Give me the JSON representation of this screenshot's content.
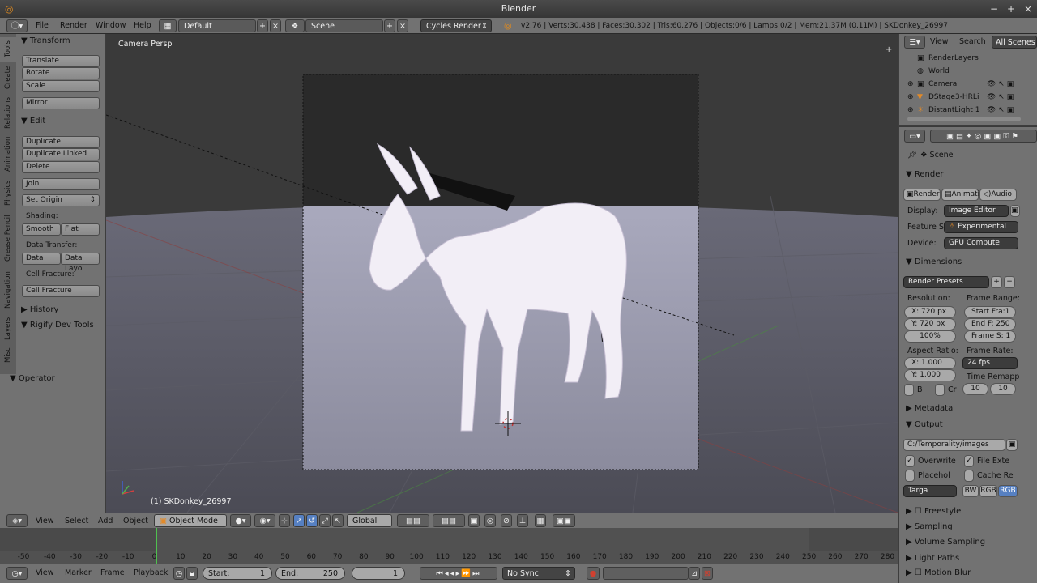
{
  "title": "Blender",
  "info": {
    "menus": [
      "File",
      "Render",
      "Window",
      "Help"
    ],
    "layout": "Default",
    "scene": "Scene",
    "engine": "Cycles Render",
    "stats": "v2.76 | Verts:30,438 | Faces:30,302 | Tris:60,276 | Objects:0/6 | Lamps:0/2 | Mem:21.37M (0.11M) | SKDonkey_26997"
  },
  "tabs": [
    "Tools",
    "Create",
    "Relations",
    "Animation",
    "Physics",
    "Grease Pencil",
    "Navigation",
    "Layers",
    "Misc"
  ],
  "tools": {
    "transform_h": "Transform",
    "translate": "Translate",
    "rotate": "Rotate",
    "scale": "Scale",
    "mirror": "Mirror",
    "edit_h": "Edit",
    "duplicate": "Duplicate",
    "duplicate_linked": "Duplicate Linked",
    "delete": "Delete",
    "join": "Join",
    "set_origin": "Set Origin",
    "shading": "Shading:",
    "smooth": "Smooth",
    "flat": "Flat",
    "data_transfer": "Data Transfer:",
    "data": "Data",
    "data_layo": "Data Layo",
    "cell_fracture_label": "Cell Fracture:",
    "cell_fracture": "Cell Fracture",
    "history_h": "History",
    "rigify_h": "Rigify Dev Tools",
    "operator_h": "Operator"
  },
  "viewport": {
    "label": "Camera Persp",
    "object_label": "(1) SKDonkey_26997"
  },
  "view_header": {
    "menus": [
      "View",
      "Select",
      "Add",
      "Object"
    ],
    "mode": "Object Mode",
    "orientation": "Global"
  },
  "timeline": {
    "ticks": [
      "-50",
      "-40",
      "-30",
      "-20",
      "-10",
      "0",
      "10",
      "20",
      "30",
      "40",
      "50",
      "60",
      "70",
      "80",
      "90",
      "100",
      "110",
      "120",
      "130",
      "140",
      "150",
      "160",
      "170",
      "180",
      "190",
      "200",
      "210",
      "220",
      "230",
      "240",
      "250",
      "260",
      "270",
      "280"
    ],
    "menus": [
      "View",
      "Marker",
      "Frame",
      "Playback"
    ],
    "start_label": "Start:",
    "start": "1",
    "end_label": "End:",
    "end": "250",
    "current": "1",
    "sync": "No Sync"
  },
  "outliner": {
    "view": "View",
    "search": "Search",
    "all_scenes": "All Scenes",
    "items": [
      "RenderLayers",
      "World",
      "Camera",
      "DStage3-HRLi",
      "DistantLight 1"
    ]
  },
  "props": {
    "scene": "Scene",
    "render_h": "Render",
    "render_btn": "Render",
    "anim_btn": "Animati",
    "audio_btn": "Audio",
    "display_label": "Display:",
    "display": "Image Editor",
    "feature_label": "Feature S",
    "feature": "Experimental",
    "device_label": "Device:",
    "device": "GPU Compute",
    "dimensions_h": "Dimensions",
    "presets": "Render Presets",
    "resolution_label": "Resolution:",
    "res_x": "X:  720 px",
    "res_y": "Y:  720 px",
    "res_pct": "100%",
    "frame_range_label": "Frame Range:",
    "start_frame": "Start Fra:1",
    "end_frame": "End F: 250",
    "frame_step": "Frame S: 1",
    "aspect_label": "Aspect Ratio:",
    "aspect_x": "X:   1.000",
    "aspect_y": "Y:   1.000",
    "frame_rate_label": "Frame Rate:",
    "frame_rate": "24 fps",
    "time_remap": "Time Remapp",
    "remap_old": "10",
    "remap_new": "10",
    "b_label": "B",
    "cr_label": "Cr",
    "metadata_h": "Metadata",
    "output_h": "Output",
    "output_path": "C:/Temporality/images",
    "overwrite": "Overwrite",
    "file_ext": "File Exte",
    "placeholders": "Placehol",
    "cache_result": "Cache Re",
    "format": "Targa",
    "bw": "BW",
    "rgb": "RGB",
    "rgba": "RGB",
    "freestyle_h": "Freestyle",
    "sampling_h": "Sampling",
    "volume_h": "Volume Sampling",
    "light_paths_h": "Light Paths",
    "motion_blur_h": "Motion Blur"
  },
  "colors": {
    "accent": "#5680c2",
    "orange": "#e28a28"
  }
}
